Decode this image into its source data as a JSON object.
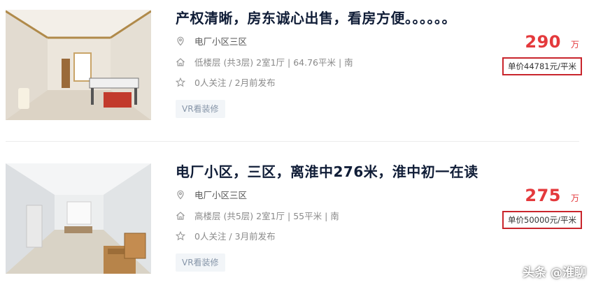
{
  "listings": [
    {
      "title": "产权清晰，房东诚心出售，看房方便。。。。。。",
      "community": "电厂小区三区",
      "house_info": "低楼层 (共3层) 2室1厅 | 64.76平米 | 南",
      "follow_info": "0人关注 / 2月前发布",
      "vr_tag": "VR看装修",
      "total_price": "290",
      "total_unit": "万",
      "unit_price": "单价44781元/平米"
    },
    {
      "title": "电厂小区，三区，离淮中276米，淮中初一在读",
      "community": "电厂小区三区",
      "house_info": "高楼层 (共5层) 2室1厅 | 55平米 | 南",
      "follow_info": "0人关注 / 3月前发布",
      "vr_tag": "VR看装修",
      "total_price": "275",
      "total_unit": "万",
      "unit_price": "单价50000元/平米"
    }
  ],
  "watermark": "头条 @淮聊",
  "colors": {
    "title": "#101d37",
    "price": "#e4393c",
    "highlight_box": "#c9252c",
    "meta_text": "#8a8a8a",
    "tag_bg": "#f2f5f8"
  },
  "icons": {
    "community": "location-pin-icon",
    "house": "home-icon",
    "follow": "star-icon"
  }
}
